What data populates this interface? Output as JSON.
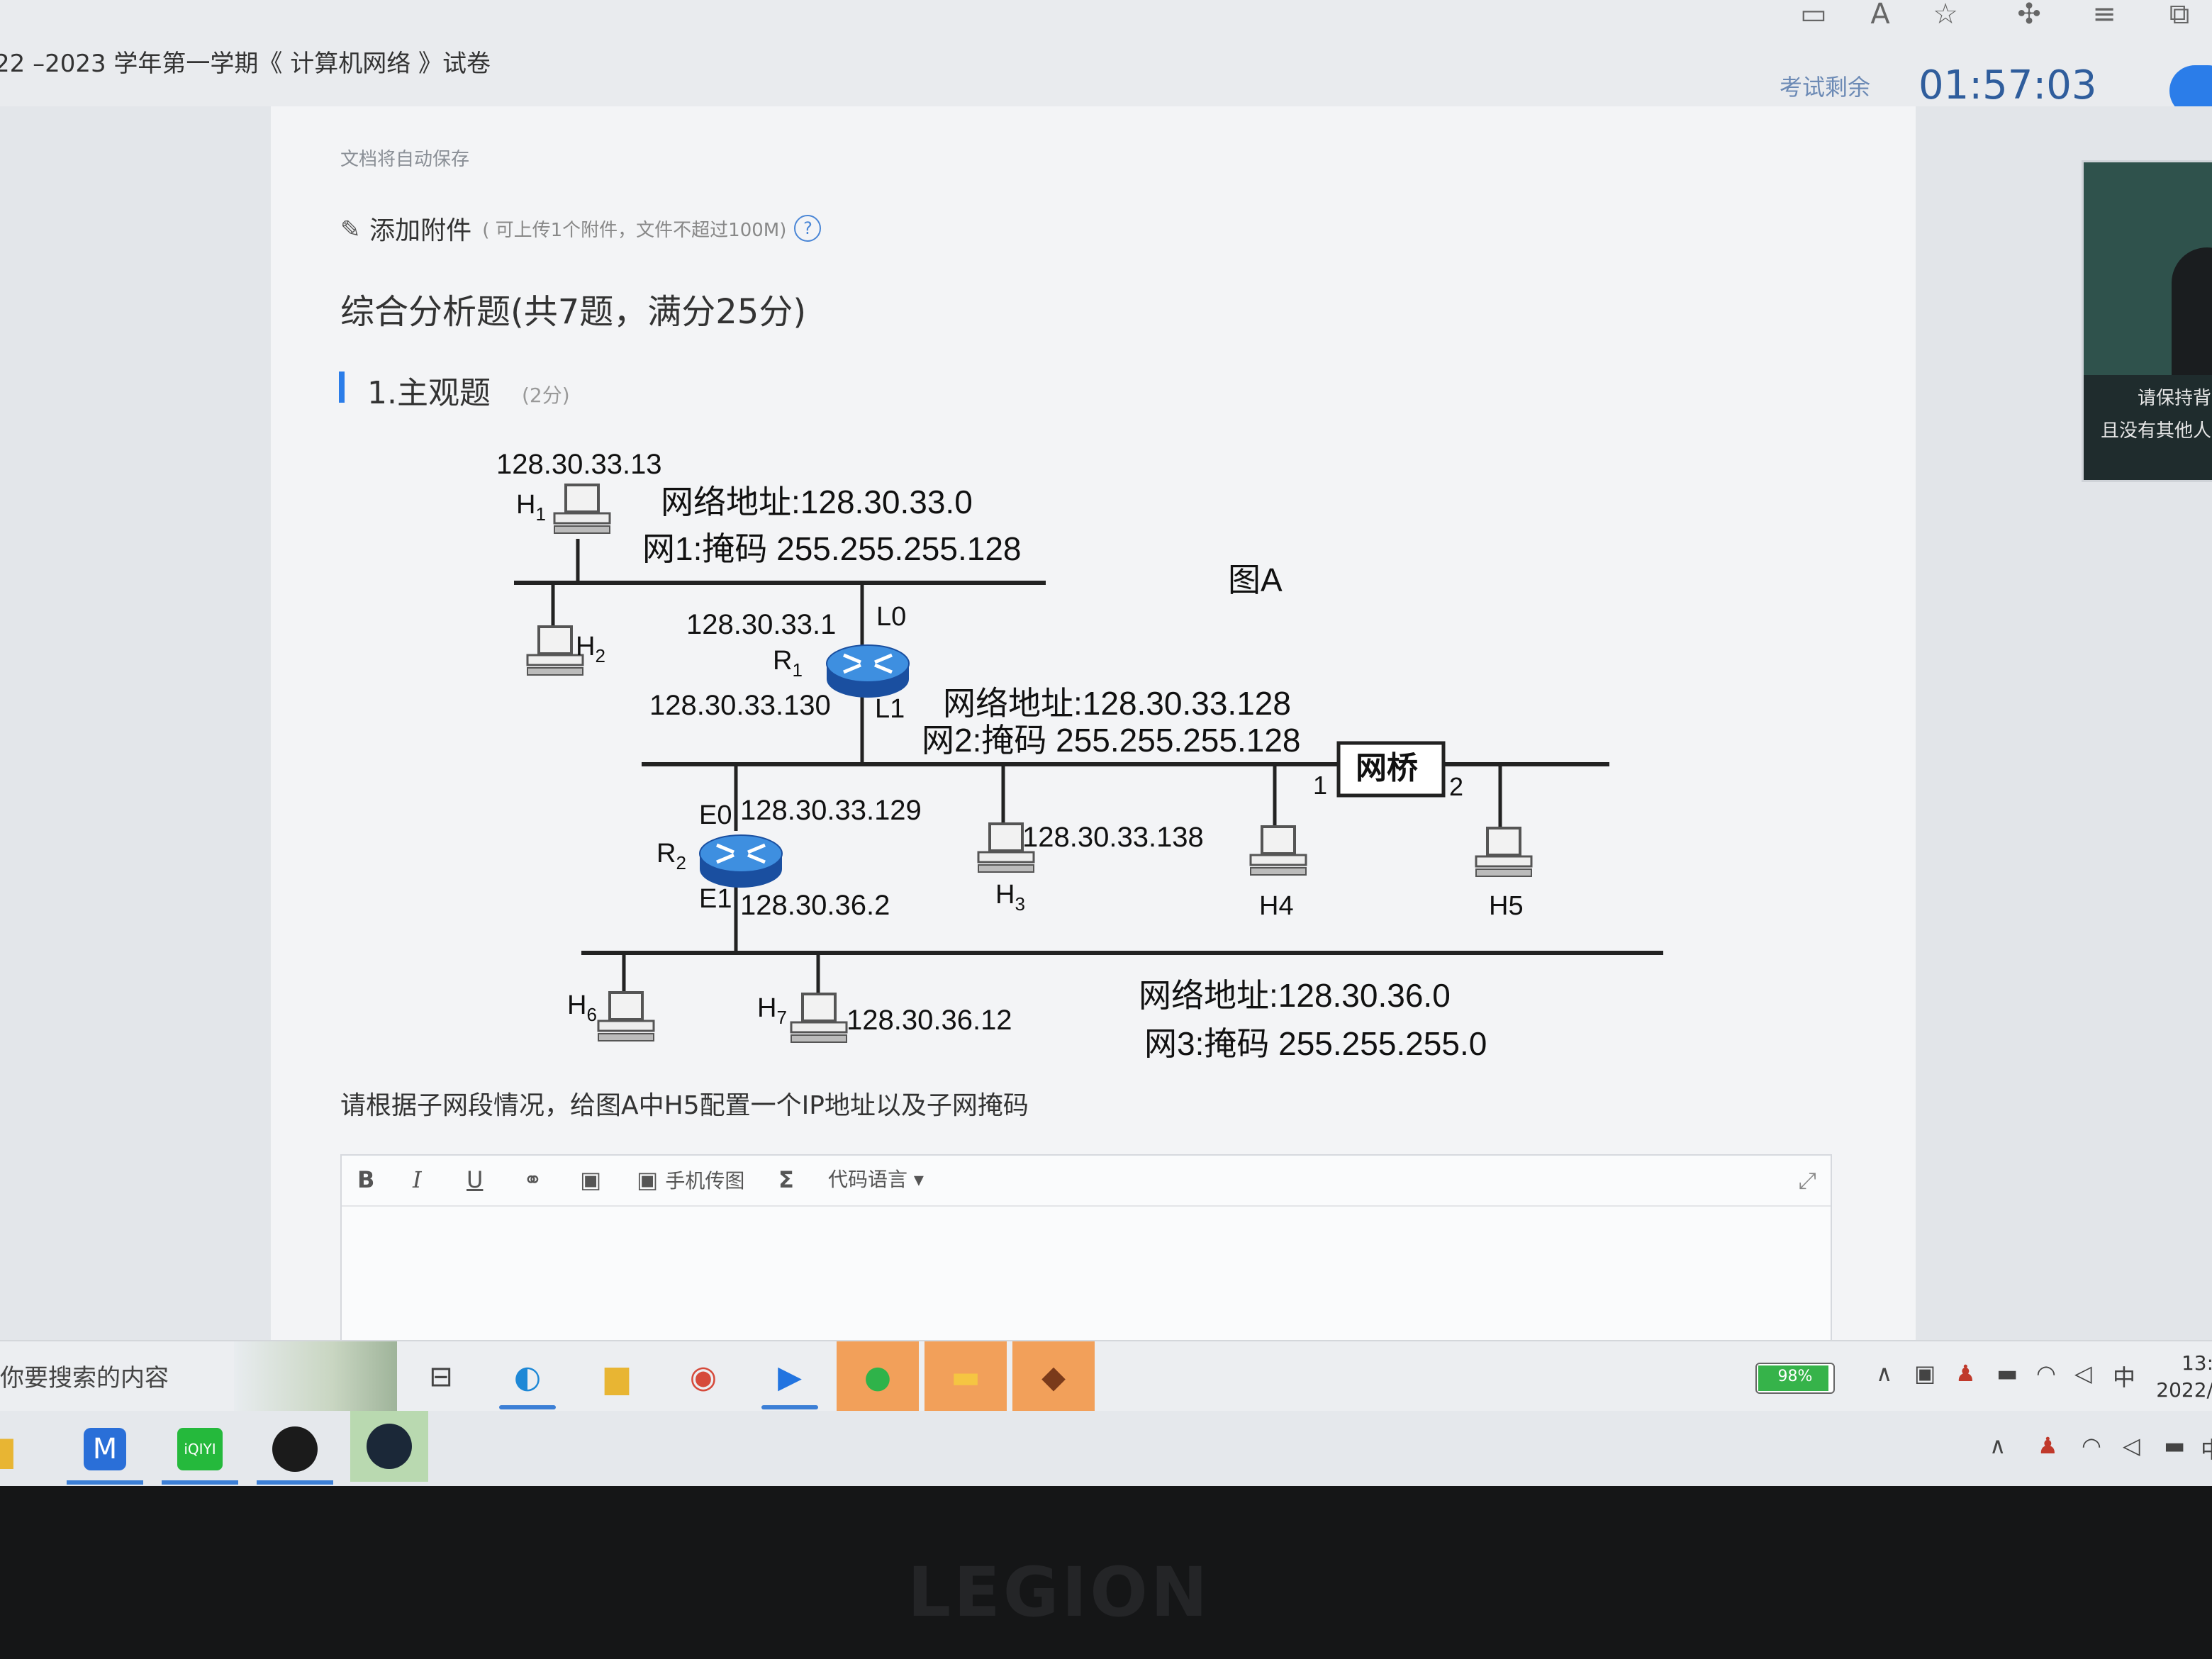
{
  "browser": {
    "toolbar_icons": [
      "reader-icon",
      "read-aloud-icon",
      "favorite-add-icon",
      "extensions-icon",
      "favorites-icon",
      "collections-icon"
    ]
  },
  "exam": {
    "title": "22 –2023 学年第一学期《 计算机网络 》试卷",
    "remaining_label": "考试剩余",
    "timer": "01:57:03"
  },
  "document": {
    "autosave": "文档将自动保存",
    "attachment_label": "添加附件",
    "attachment_note": "( 可上传1个附件，文件不超过100M)",
    "help": "?",
    "section_title": "综合分析题(共7题，满分25分)",
    "question_title": "1.主观题",
    "question_points": "(2分)",
    "question_text": "请根据子网段情况，给图A中H5配置一个IP地址以及子网掩码"
  },
  "diagram": {
    "figure_label": "图A",
    "net1": {
      "address": "网络地址:128.30.33.0",
      "mask": "网1:掩码 255.255.255.128"
    },
    "net2": {
      "address": "网络地址:128.30.33.128",
      "mask": "网2:掩码 255.255.255.128"
    },
    "net3": {
      "address": "网络地址:128.30.36.0",
      "mask": "网3:掩码 255.255.255.0"
    },
    "h1_ip": "128.30.33.13",
    "r1": {
      "name": "R",
      "sub": "1",
      "l0_label": "L0",
      "l0_ip": "128.30.33.1",
      "l1_label": "L1",
      "l1_ip": "128.30.33.130"
    },
    "r2": {
      "name": "R",
      "sub": "2",
      "e0_label": "E0",
      "e0_ip": "128.30.33.129",
      "e1_label": "E1",
      "e1_ip": "128.30.36.2"
    },
    "h3_ip": "128.30.33.138",
    "h7_ip": "128.30.36.12",
    "bridge": {
      "label": "网桥",
      "port1": "1",
      "port2": "2"
    },
    "hosts": {
      "h1": {
        "name": "H",
        "sub": "1"
      },
      "h2": {
        "name": "H",
        "sub": "2"
      },
      "h3": {
        "name": "H",
        "sub": "3"
      },
      "h4": "H4",
      "h5": "H5",
      "h6": {
        "name": "H",
        "sub": "6"
      },
      "h7": {
        "name": "H",
        "sub": "7"
      }
    }
  },
  "editor": {
    "bold": "B",
    "italic": "I",
    "underline": "U",
    "phone_upload": "手机传图",
    "formula": "Σ",
    "code_language": "代码语言 ▾"
  },
  "webcam": {
    "line1": "请保持背",
    "line2": "且没有其他人"
  },
  "taskbar": {
    "search": "你要搜索的内容",
    "battery": "98%",
    "ime": "中",
    "clock_time": "13:",
    "clock_date": "2022/"
  },
  "taskbar2": {
    "ime": "中"
  },
  "brand": "LEGION",
  "colors": {
    "accent": "#2b7de9",
    "timer": "#2f5d9c",
    "highlight_app": "#f2a05a"
  }
}
